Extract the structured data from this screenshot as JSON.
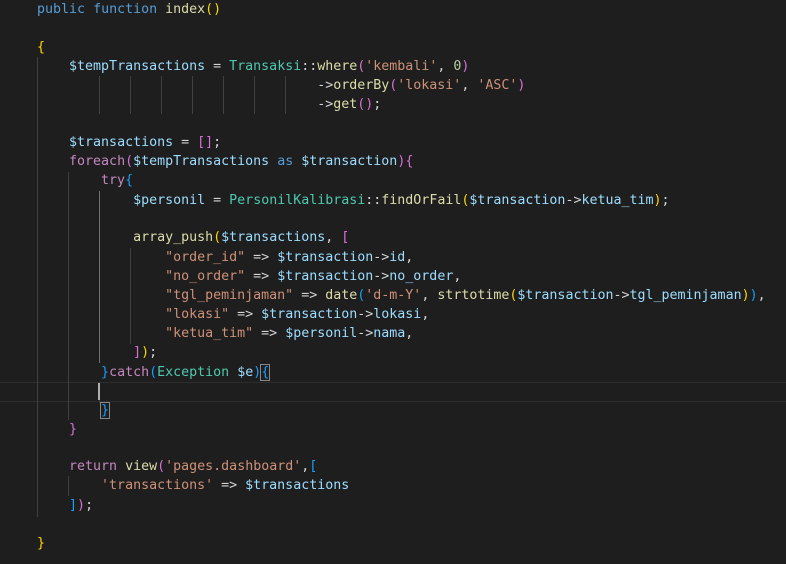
{
  "editor": {
    "lines": [
      {
        "id": "l0",
        "tokens": [
          [
            "kw",
            "public"
          ],
          [
            "pun",
            " "
          ],
          [
            "kw",
            "function"
          ],
          [
            "pun",
            " "
          ],
          [
            "fn",
            "index"
          ],
          [
            "b1",
            "()"
          ]
        ]
      },
      {
        "id": "l2",
        "tokens": [
          [
            "b1",
            "{"
          ]
        ]
      },
      {
        "id": "l3",
        "tokens": [
          [
            "pun",
            "    "
          ],
          [
            "var",
            "$tempTransactions"
          ],
          [
            "pun",
            " = "
          ],
          [
            "cls",
            "Transaksi"
          ],
          [
            "pun",
            "::"
          ],
          [
            "fn",
            "where"
          ],
          [
            "b2",
            "("
          ],
          [
            "str",
            "'kembali'"
          ],
          [
            "pun",
            ", "
          ],
          [
            "num",
            "0"
          ],
          [
            "b2",
            ")"
          ]
        ]
      },
      {
        "id": "l4",
        "tokens": [
          [
            "pun",
            "                                   ->"
          ],
          [
            "fn",
            "orderBy"
          ],
          [
            "b2",
            "("
          ],
          [
            "str",
            "'lokasi'"
          ],
          [
            "pun",
            ", "
          ],
          [
            "str",
            "'ASC'"
          ],
          [
            "b2",
            ")"
          ]
        ]
      },
      {
        "id": "l5",
        "tokens": [
          [
            "pun",
            "                                   ->"
          ],
          [
            "fn",
            "get"
          ],
          [
            "b2",
            "()"
          ],
          [
            "pun",
            ";"
          ]
        ]
      },
      {
        "id": "l7",
        "tokens": [
          [
            "pun",
            "    "
          ],
          [
            "var",
            "$transactions"
          ],
          [
            "pun",
            " = "
          ],
          [
            "b2",
            "[]"
          ],
          [
            "pun",
            ";"
          ]
        ]
      },
      {
        "id": "l8",
        "tokens": [
          [
            "pun",
            "    "
          ],
          [
            "ctl",
            "foreach"
          ],
          [
            "b2",
            "("
          ],
          [
            "var",
            "$tempTransactions"
          ],
          [
            "pun",
            " "
          ],
          [
            "kw",
            "as"
          ],
          [
            "pun",
            " "
          ],
          [
            "var",
            "$transaction"
          ],
          [
            "b2",
            ")"
          ],
          [
            "b2",
            "{"
          ]
        ]
      },
      {
        "id": "l9",
        "tokens": [
          [
            "pun",
            "        "
          ],
          [
            "ctl",
            "try"
          ],
          [
            "b3",
            "{"
          ]
        ]
      },
      {
        "id": "l10",
        "tokens": [
          [
            "pun",
            "            "
          ],
          [
            "var",
            "$personil"
          ],
          [
            "pun",
            " = "
          ],
          [
            "cls",
            "PersonilKalibrasi"
          ],
          [
            "pun",
            "::"
          ],
          [
            "fn",
            "findOrFail"
          ],
          [
            "b1",
            "("
          ],
          [
            "var",
            "$transaction"
          ],
          [
            "pun",
            "->"
          ],
          [
            "var",
            "ketua_tim"
          ],
          [
            "b1",
            ")"
          ],
          [
            "pun",
            ";"
          ]
        ]
      },
      {
        "id": "l12",
        "tokens": [
          [
            "pun",
            "            "
          ],
          [
            "fn",
            "array_push"
          ],
          [
            "b1",
            "("
          ],
          [
            "var",
            "$transactions"
          ],
          [
            "pun",
            ", "
          ],
          [
            "b2",
            "["
          ]
        ]
      },
      {
        "id": "l13",
        "tokens": [
          [
            "pun",
            "                "
          ],
          [
            "str",
            "\"order_id\""
          ],
          [
            "pun",
            " => "
          ],
          [
            "var",
            "$transaction"
          ],
          [
            "pun",
            "->"
          ],
          [
            "var",
            "id"
          ],
          [
            "pun",
            ","
          ]
        ]
      },
      {
        "id": "l14",
        "tokens": [
          [
            "pun",
            "                "
          ],
          [
            "str",
            "\"no_order\""
          ],
          [
            "pun",
            " => "
          ],
          [
            "var",
            "$transaction"
          ],
          [
            "pun",
            "->"
          ],
          [
            "var",
            "no_order"
          ],
          [
            "pun",
            ","
          ]
        ]
      },
      {
        "id": "l15",
        "tokens": [
          [
            "pun",
            "                "
          ],
          [
            "str",
            "\"tgl_peminjaman\""
          ],
          [
            "pun",
            " => "
          ],
          [
            "fn",
            "date"
          ],
          [
            "b3",
            "("
          ],
          [
            "str",
            "'d-m-Y'"
          ],
          [
            "pun",
            ", "
          ],
          [
            "fn",
            "strtotime"
          ],
          [
            "b1",
            "("
          ],
          [
            "var",
            "$transaction"
          ],
          [
            "pun",
            "->"
          ],
          [
            "var",
            "tgl_peminjaman"
          ],
          [
            "b1",
            ")"
          ],
          [
            "b3",
            ")"
          ],
          [
            "pun",
            ","
          ]
        ]
      },
      {
        "id": "l16",
        "tokens": [
          [
            "pun",
            "                "
          ],
          [
            "str",
            "\"lokasi\""
          ],
          [
            "pun",
            " => "
          ],
          [
            "var",
            "$transaction"
          ],
          [
            "pun",
            "->"
          ],
          [
            "var",
            "lokasi"
          ],
          [
            "pun",
            ","
          ]
        ]
      },
      {
        "id": "l17",
        "tokens": [
          [
            "pun",
            "                "
          ],
          [
            "str",
            "\"ketua_tim\""
          ],
          [
            "pun",
            " => "
          ],
          [
            "var",
            "$personil"
          ],
          [
            "pun",
            "->"
          ],
          [
            "var",
            "nama"
          ],
          [
            "pun",
            ","
          ]
        ]
      },
      {
        "id": "l18",
        "tokens": [
          [
            "pun",
            "            "
          ],
          [
            "b2",
            "]"
          ],
          [
            "b1",
            ")"
          ],
          [
            "pun",
            ";"
          ]
        ]
      },
      {
        "id": "l19",
        "tokens": [
          [
            "pun",
            "        "
          ],
          [
            "b3",
            "}"
          ],
          [
            "ctl",
            "catch"
          ],
          [
            "b3",
            "("
          ],
          [
            "cls",
            "Exception"
          ],
          [
            "pun",
            " "
          ],
          [
            "var",
            "$e"
          ],
          [
            "b3",
            ")"
          ],
          [
            "b3m",
            "{"
          ]
        ]
      },
      {
        "id": "l21",
        "tokens": [
          [
            "pun",
            "        "
          ],
          [
            "b3m",
            "}"
          ]
        ]
      },
      {
        "id": "l22",
        "tokens": [
          [
            "pun",
            "    "
          ],
          [
            "b2",
            "}"
          ]
        ]
      },
      {
        "id": "l24",
        "tokens": [
          [
            "pun",
            "    "
          ],
          [
            "ctl",
            "return"
          ],
          [
            "pun",
            " "
          ],
          [
            "fn",
            "view"
          ],
          [
            "b2",
            "("
          ],
          [
            "str",
            "'pages.dashboard'"
          ],
          [
            "pun",
            ","
          ],
          [
            "b3",
            "["
          ]
        ]
      },
      {
        "id": "l25",
        "tokens": [
          [
            "pun",
            "        "
          ],
          [
            "str",
            "'transactions'"
          ],
          [
            "pun",
            " => "
          ],
          [
            "var",
            "$transactions"
          ]
        ]
      },
      {
        "id": "l26",
        "tokens": [
          [
            "pun",
            "    "
          ],
          [
            "b3",
            "]"
          ],
          [
            "b2",
            ")"
          ],
          [
            "pun",
            ";"
          ]
        ]
      },
      {
        "id": "l28",
        "tokens": [
          [
            "b1",
            "}"
          ]
        ]
      }
    ]
  },
  "colors": {
    "background": "#1e1e1e",
    "keyword": "#569cd6",
    "control": "#c586c0",
    "function": "#dcdcaa",
    "variable": "#9cdcfe",
    "class": "#4ec9b0",
    "string": "#ce9178",
    "number": "#b5cea8",
    "bracket1": "#ffd700",
    "bracket2": "#da70d6",
    "bracket3": "#179fff"
  }
}
